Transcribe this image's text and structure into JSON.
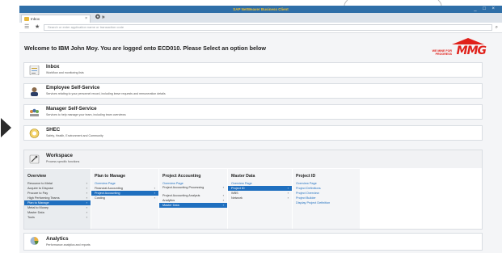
{
  "window": {
    "title": "SAP NetWeaver Business Client",
    "controls": "_ □ ×"
  },
  "tabs": [
    {
      "label": "Inbox"
    }
  ],
  "tab_nav": "✪ »",
  "toolbar": {
    "search_placeholder": "Search or enter application name or transaction code"
  },
  "welcome": "Welcome to IBM John Moy. You are logged onto ECD010. Please Select an option below",
  "logo": {
    "tagline": "WE MINE FOR PROGRESS",
    "brand": "MMG",
    "color": "#e0201a"
  },
  "cards": [
    {
      "title": "Inbox",
      "subtitle": "Workflow and monitoring lists"
    },
    {
      "title": "Employee Self-Service",
      "subtitle": "Services relating to your personnel record, including leave requests and remuneration details"
    },
    {
      "title": "Manager Self-Service",
      "subtitle": "Services to help manage your team, including team overviews"
    },
    {
      "title": "SHEC",
      "subtitle": "Safety, Health, Environment and Community"
    }
  ],
  "workspace": {
    "title": "Workspace",
    "subtitle": "Process specific functions",
    "columns": [
      {
        "header": "Overview",
        "items": [
          {
            "label": "Resource to Metal",
            "chevron": true
          },
          {
            "label": "Acquire to Dispose",
            "chevron": true
          },
          {
            "label": "Procure to Pay",
            "chevron": true
          },
          {
            "label": "High Performing Teams",
            "chevron": true
          },
          {
            "label": "Plan to Manage",
            "chevron": true,
            "selected": true
          },
          {
            "label": "Metal to Money",
            "chevron": true
          },
          {
            "label": "Master Data",
            "chevron": true
          },
          {
            "label": "Tools",
            "chevron": true
          }
        ]
      },
      {
        "header": "Plan to Manage",
        "items": [
          {
            "label": "Overview Page",
            "link": true
          },
          {
            "label": "Financial Accounting",
            "chevron": true
          },
          {
            "label": "Project Accounting",
            "chevron": true,
            "selected": true
          },
          {
            "label": "Costing",
            "chevron": true
          }
        ]
      },
      {
        "header": "Project Accounting",
        "items": [
          {
            "label": "Overview Page",
            "link": true
          },
          {
            "label": "Project Accounting Processing",
            "chevron": true,
            "tall": true
          },
          {
            "label": "Project Accounting Analysis",
            "chevron": true
          },
          {
            "label": "Analytics",
            "chevron": true
          },
          {
            "label": "Master Data",
            "chevron": true,
            "selected": true
          }
        ]
      },
      {
        "header": "Master Data",
        "items": [
          {
            "label": "Overview Page",
            "link": true
          },
          {
            "label": "Project ID",
            "chevron": true,
            "selected": true
          },
          {
            "label": "WBS",
            "chevron": true
          },
          {
            "label": "Network",
            "chevron": true
          }
        ]
      },
      {
        "header": "Project ID",
        "items": [
          {
            "label": "Overview Page",
            "link": true
          },
          {
            "label": "Project Definitions",
            "link": true
          },
          {
            "label": "Project Overview",
            "link": true
          },
          {
            "label": "Project Builder",
            "link": true
          },
          {
            "label": "Display Project Definition",
            "link": true
          }
        ]
      }
    ]
  },
  "analytics": {
    "title": "Analytics",
    "subtitle": "Performance analytics and reports"
  }
}
